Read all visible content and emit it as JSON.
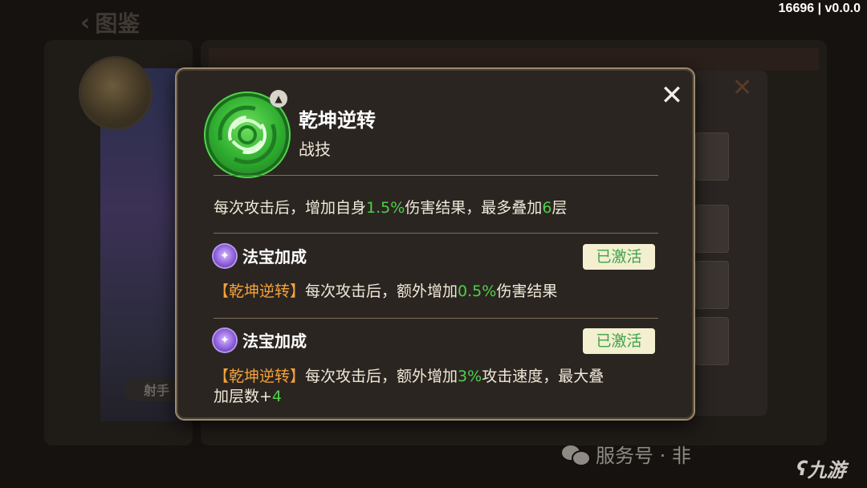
{
  "background": {
    "back_label": "图鉴",
    "archer_label": "射手"
  },
  "version": "16696 | v0.0.0",
  "watermark": {
    "text": "服务号 · 非",
    "logo_text": "九游"
  },
  "modal": {
    "skill": {
      "name": "乾坤逆转",
      "type": "战技",
      "icon": "swirl-green-icon",
      "desc_parts": [
        "每次攻击后，增加自身",
        "1.5%",
        "伤害结果，最多叠加",
        "6",
        "层"
      ]
    },
    "bonuses": [
      {
        "title": "法宝加成",
        "status": "已激活",
        "tag": "【乾坤逆转】",
        "desc_parts": [
          "每次攻击后，额外增加",
          "0.5%",
          "伤害结果"
        ]
      },
      {
        "title": "法宝加成",
        "status": "已激活",
        "tag": "【乾坤逆转】",
        "desc_parts": [
          "每次攻击后，额外增加",
          "3%",
          "攻击速度，最大叠",
          "加层数+",
          "4"
        ]
      }
    ]
  },
  "colors": {
    "highlight_green": "#4fcf4a",
    "tag_orange": "#f3a23a",
    "modal_bg": "#2b2521",
    "badge_bg": "#f3efd0"
  }
}
